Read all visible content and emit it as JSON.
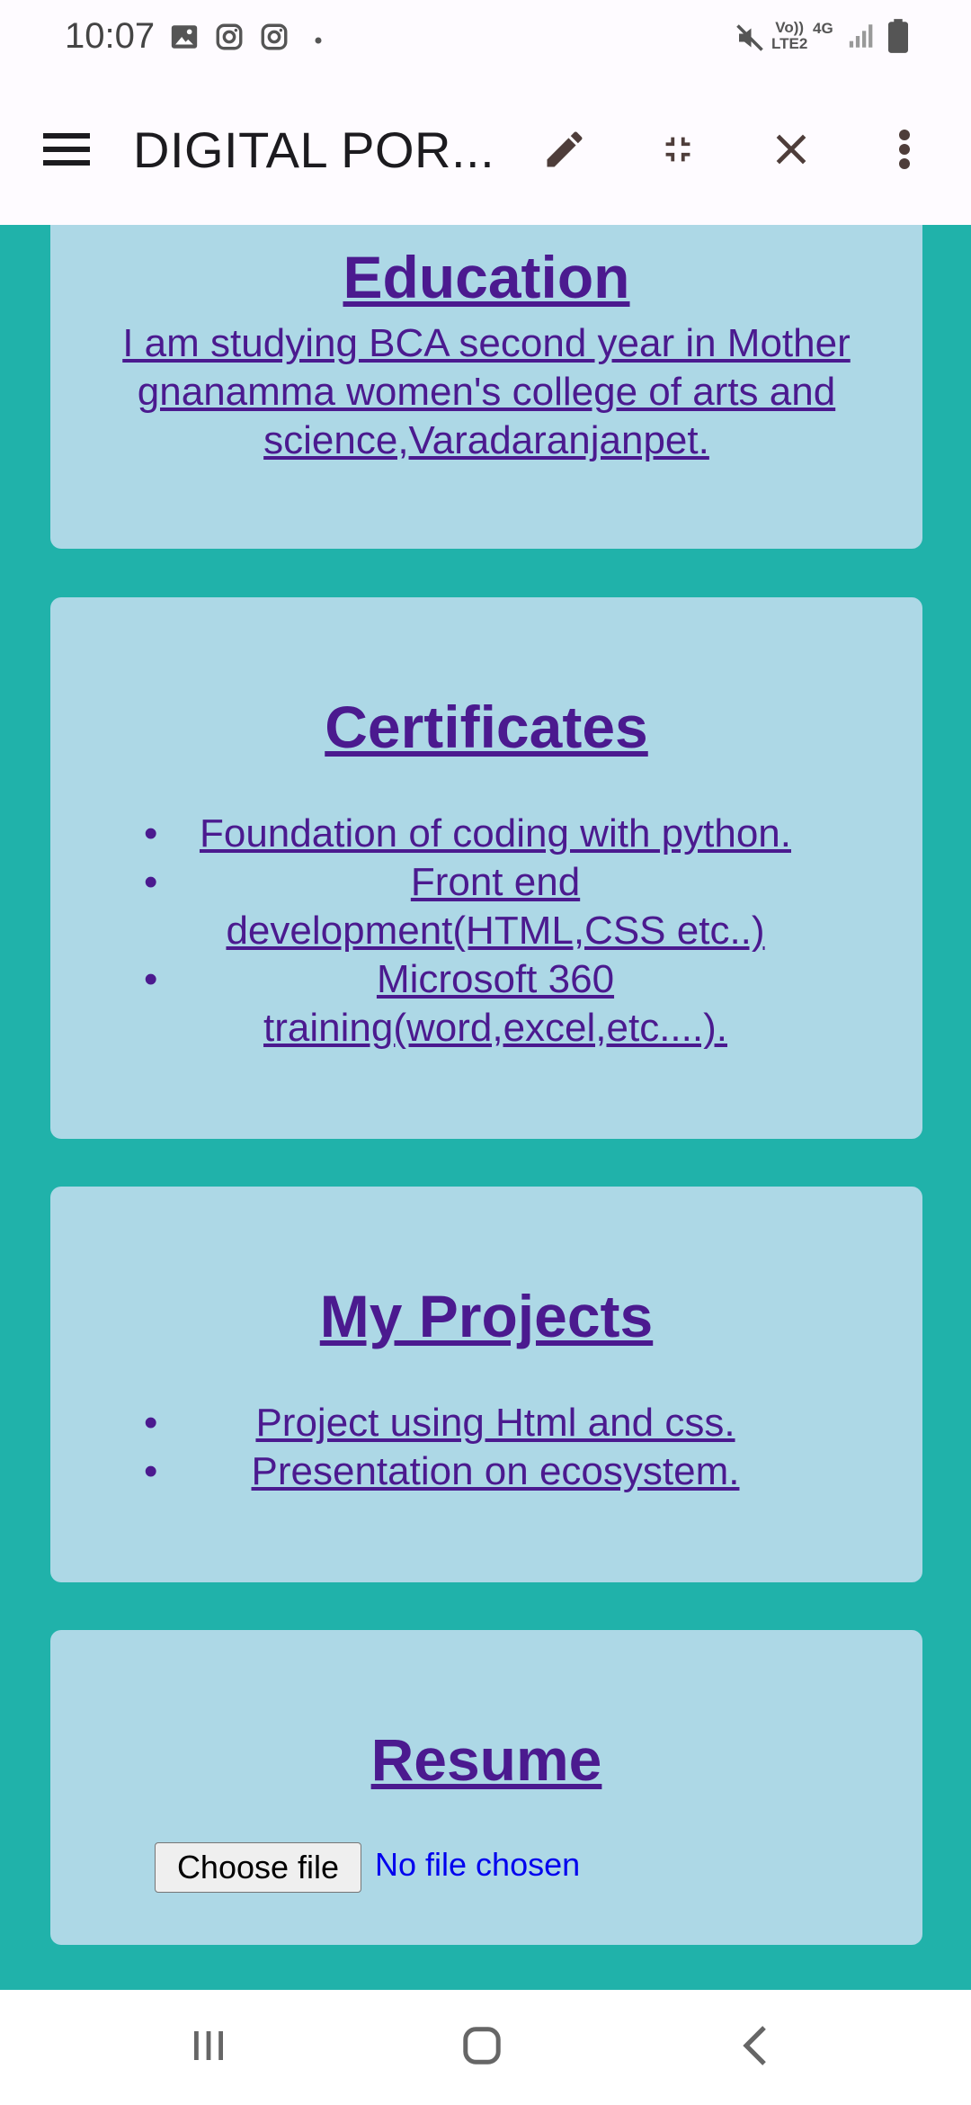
{
  "status_bar": {
    "time": "10:07",
    "left_icons": [
      "gallery-icon",
      "instagram-icon",
      "instagram-icon",
      "dot-icon"
    ],
    "network_label_top": "Vo))",
    "network_label_bottom": "LTE2",
    "network_type": "4G",
    "right_icons": [
      "mute-icon",
      "signal-icon",
      "battery-icon"
    ]
  },
  "app_bar": {
    "title": "DIGITAL POR...",
    "actions": [
      "menu-icon",
      "edit-icon",
      "fullscreen-exit-icon",
      "close-icon",
      "more-vert-icon"
    ]
  },
  "sections": {
    "education": {
      "heading": "Education",
      "text": "I am studying BCA second year in Mother gnanamma women's college of arts and science,Varadaranjanpet."
    },
    "certificates": {
      "heading": "Certificates",
      "items": [
        "Foundation of coding with python.",
        "Front end development(HTML,CSS etc..)",
        "Microsoft 360 training(word,excel,etc....)."
      ]
    },
    "projects": {
      "heading": "My Projects",
      "items": [
        "Project using Html and css.",
        "Presentation on ecosystem."
      ]
    },
    "resume": {
      "heading": "Resume",
      "file_button": "Choose file",
      "file_status": "No file chosen"
    }
  },
  "colors": {
    "page_background": "#20b2aa",
    "card_background": "#add8e6",
    "text": "#4b1a8f",
    "link_blue": "#0000ee"
  },
  "nav_bar": {
    "buttons": [
      "recents-icon",
      "home-icon",
      "back-icon"
    ]
  }
}
